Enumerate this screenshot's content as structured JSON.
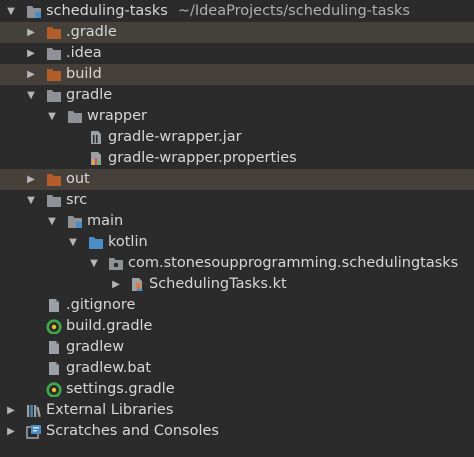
{
  "project": {
    "name": "scheduling-tasks",
    "path": "~/IdeaProjects/scheduling-tasks"
  },
  "colors": {
    "excluded_folder": "#b35d2a",
    "folder": "#8e9296",
    "source_folder": "#4a8cc4",
    "highlight_row": "#45403a"
  },
  "tree": [
    {
      "label": "scheduling-tasks",
      "toggle": "expanded",
      "icon": "project-module-folder-icon",
      "highlight": false
    },
    {
      "label": ".gradle",
      "toggle": "collapsed",
      "icon": "excluded-folder-icon",
      "highlight": true
    },
    {
      "label": ".idea",
      "toggle": "collapsed",
      "icon": "folder-icon",
      "highlight": false
    },
    {
      "label": "build",
      "toggle": "collapsed",
      "icon": "excluded-folder-icon",
      "highlight": true
    },
    {
      "label": "gradle",
      "toggle": "expanded",
      "icon": "folder-icon",
      "highlight": false
    },
    {
      "label": "wrapper",
      "toggle": "expanded",
      "icon": "folder-icon",
      "highlight": false
    },
    {
      "label": "gradle-wrapper.jar",
      "toggle": "none",
      "icon": "jar-file-icon",
      "highlight": false
    },
    {
      "label": "gradle-wrapper.properties",
      "toggle": "none",
      "icon": "properties-file-icon",
      "highlight": false
    },
    {
      "label": "out",
      "toggle": "collapsed",
      "icon": "excluded-folder-icon",
      "highlight": true
    },
    {
      "label": "src",
      "toggle": "expanded",
      "icon": "folder-icon",
      "highlight": false
    },
    {
      "label": "main",
      "toggle": "expanded",
      "icon": "source-root-folder-icon",
      "highlight": false
    },
    {
      "label": "kotlin",
      "toggle": "expanded",
      "icon": "source-folder-icon",
      "highlight": false
    },
    {
      "label": "com.stonesoupprogramming.schedulingtasks",
      "toggle": "expanded",
      "icon": "package-icon",
      "highlight": false
    },
    {
      "label": "SchedulingTasks.kt",
      "toggle": "collapsed",
      "icon": "kotlin-file-icon",
      "highlight": false
    },
    {
      "label": ".gitignore",
      "toggle": "none",
      "icon": "text-file-icon",
      "highlight": false
    },
    {
      "label": "build.gradle",
      "toggle": "none",
      "icon": "gradle-file-icon",
      "highlight": false
    },
    {
      "label": "gradlew",
      "toggle": "none",
      "icon": "text-file-icon",
      "highlight": false
    },
    {
      "label": "gradlew.bat",
      "toggle": "none",
      "icon": "text-file-icon",
      "highlight": false
    },
    {
      "label": "settings.gradle",
      "toggle": "none",
      "icon": "gradle-file-icon",
      "highlight": false
    },
    {
      "label": "External Libraries",
      "toggle": "collapsed",
      "icon": "libraries-icon",
      "highlight": false
    },
    {
      "label": "Scratches and Consoles",
      "toggle": "collapsed",
      "icon": "scratches-icon",
      "highlight": false
    }
  ]
}
